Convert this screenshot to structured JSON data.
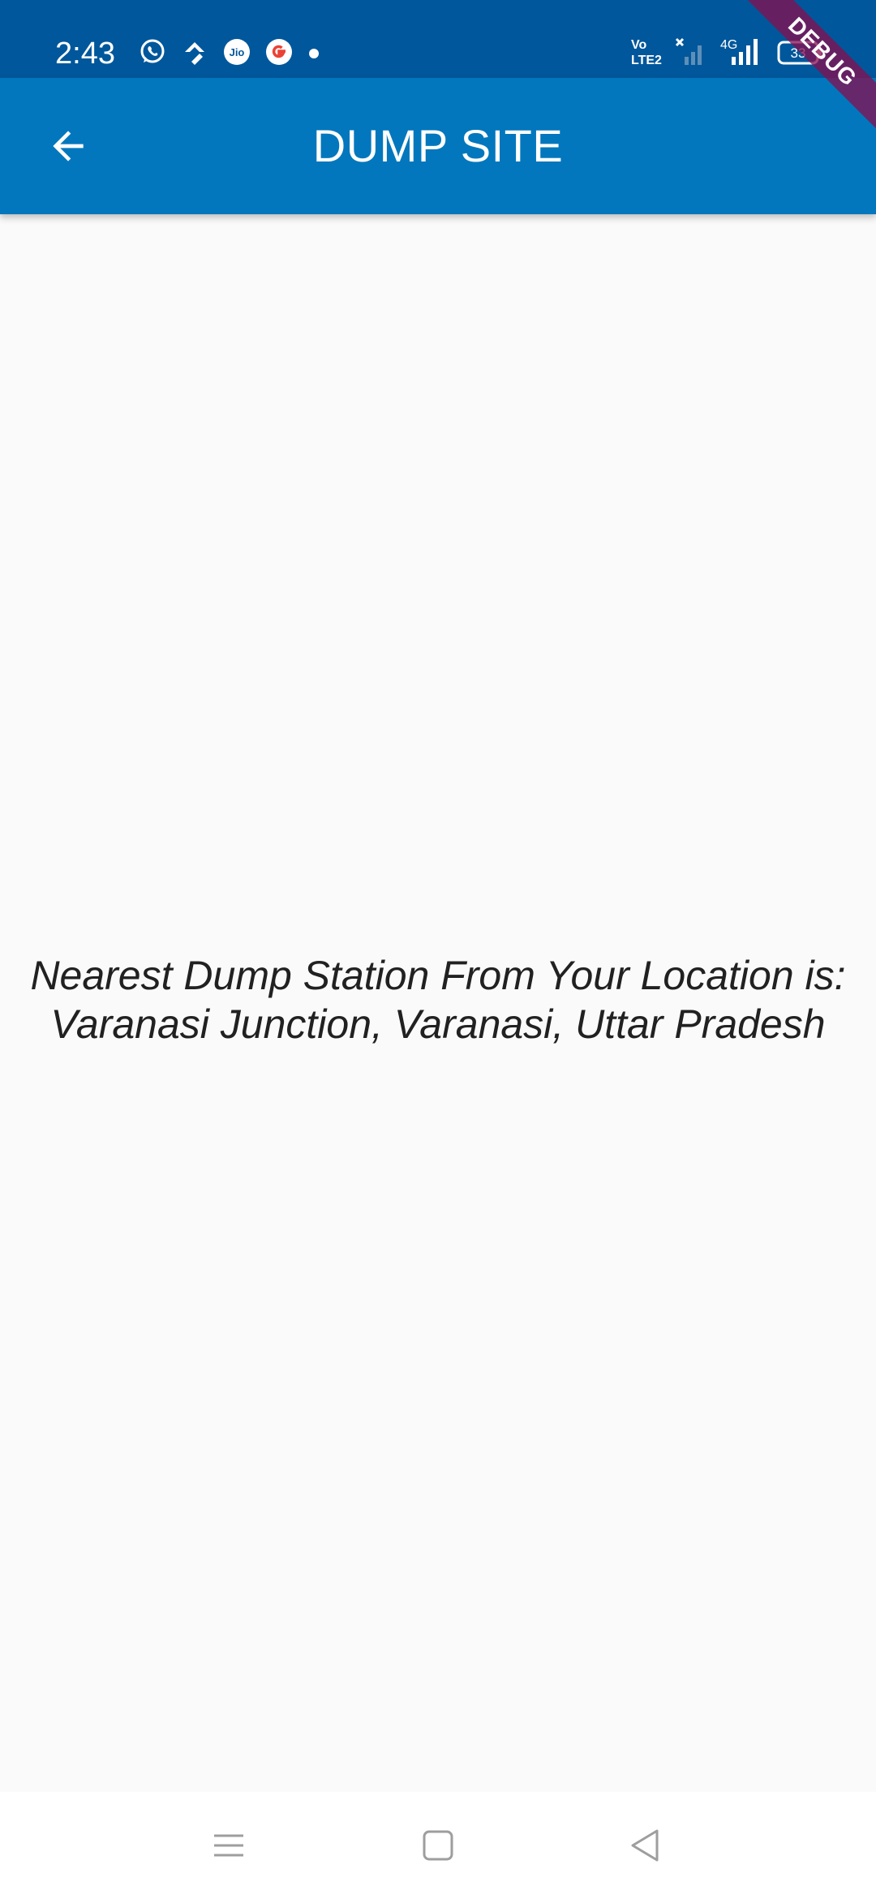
{
  "status_bar": {
    "time": "2:43",
    "network_label": "4G",
    "volte_label_top": "Vo",
    "volte_label_bottom": "LTE2",
    "battery_level": "33",
    "icons": [
      "whatsapp-icon",
      "app-notification-icon",
      "jio-icon",
      "google-icon",
      "dot-icon",
      "volte-icon",
      "sim1-signal-icon",
      "sim2-signal-icon",
      "battery-icon"
    ]
  },
  "debug_banner": "DEBUG",
  "app_bar": {
    "title": "DUMP SITE",
    "back_icon": "arrow-back-icon",
    "color": "#0277bd"
  },
  "main": {
    "line1": "Nearest Dump Station From Your Location is:",
    "line2": "Varanasi Junction, Varanasi, Uttar Pradesh"
  },
  "nav_bar": {
    "icons": [
      "menu-icon",
      "home-icon",
      "back-triangle-icon"
    ]
  }
}
